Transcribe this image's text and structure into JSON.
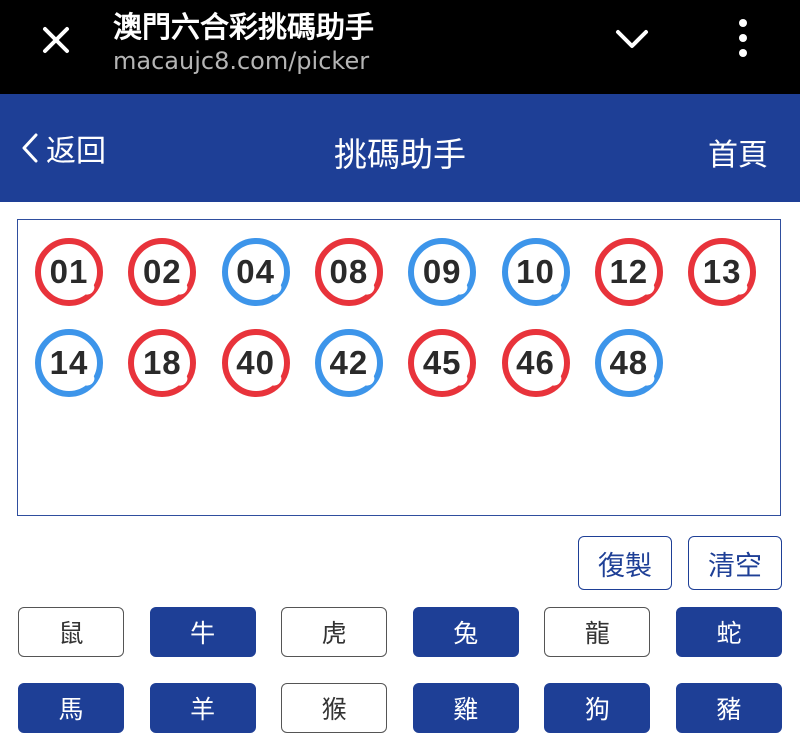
{
  "browser": {
    "title": "澳門六合彩挑碼助手",
    "url": "macaujc8.com/picker"
  },
  "header": {
    "back_label": "返回",
    "title": "挑碼助手",
    "home_label": "首頁",
    "bg_color": "#1e3f96"
  },
  "balls": [
    {
      "num": "01",
      "color": "red"
    },
    {
      "num": "02",
      "color": "red"
    },
    {
      "num": "04",
      "color": "blue"
    },
    {
      "num": "08",
      "color": "red"
    },
    {
      "num": "09",
      "color": "blue"
    },
    {
      "num": "10",
      "color": "blue"
    },
    {
      "num": "12",
      "color": "red"
    },
    {
      "num": "13",
      "color": "red"
    },
    {
      "num": "14",
      "color": "blue"
    },
    {
      "num": "18",
      "color": "red"
    },
    {
      "num": "40",
      "color": "red"
    },
    {
      "num": "42",
      "color": "blue"
    },
    {
      "num": "45",
      "color": "red"
    },
    {
      "num": "46",
      "color": "red"
    },
    {
      "num": "48",
      "color": "blue"
    }
  ],
  "actions": {
    "copy_label": "復製",
    "clear_label": "清空"
  },
  "zodiacs": [
    {
      "label": "鼠",
      "selected": false
    },
    {
      "label": "牛",
      "selected": true
    },
    {
      "label": "虎",
      "selected": false
    },
    {
      "label": "兔",
      "selected": true
    },
    {
      "label": "龍",
      "selected": false
    },
    {
      "label": "蛇",
      "selected": true
    },
    {
      "label": "馬",
      "selected": true
    },
    {
      "label": "羊",
      "selected": true
    },
    {
      "label": "猴",
      "selected": false
    },
    {
      "label": "雞",
      "selected": true
    },
    {
      "label": "狗",
      "selected": true
    },
    {
      "label": "豬",
      "selected": true
    }
  ],
  "colors": {
    "red_ball": "#e8333b",
    "blue_ball": "#3d95ea",
    "brand_blue": "#1e3f96"
  }
}
